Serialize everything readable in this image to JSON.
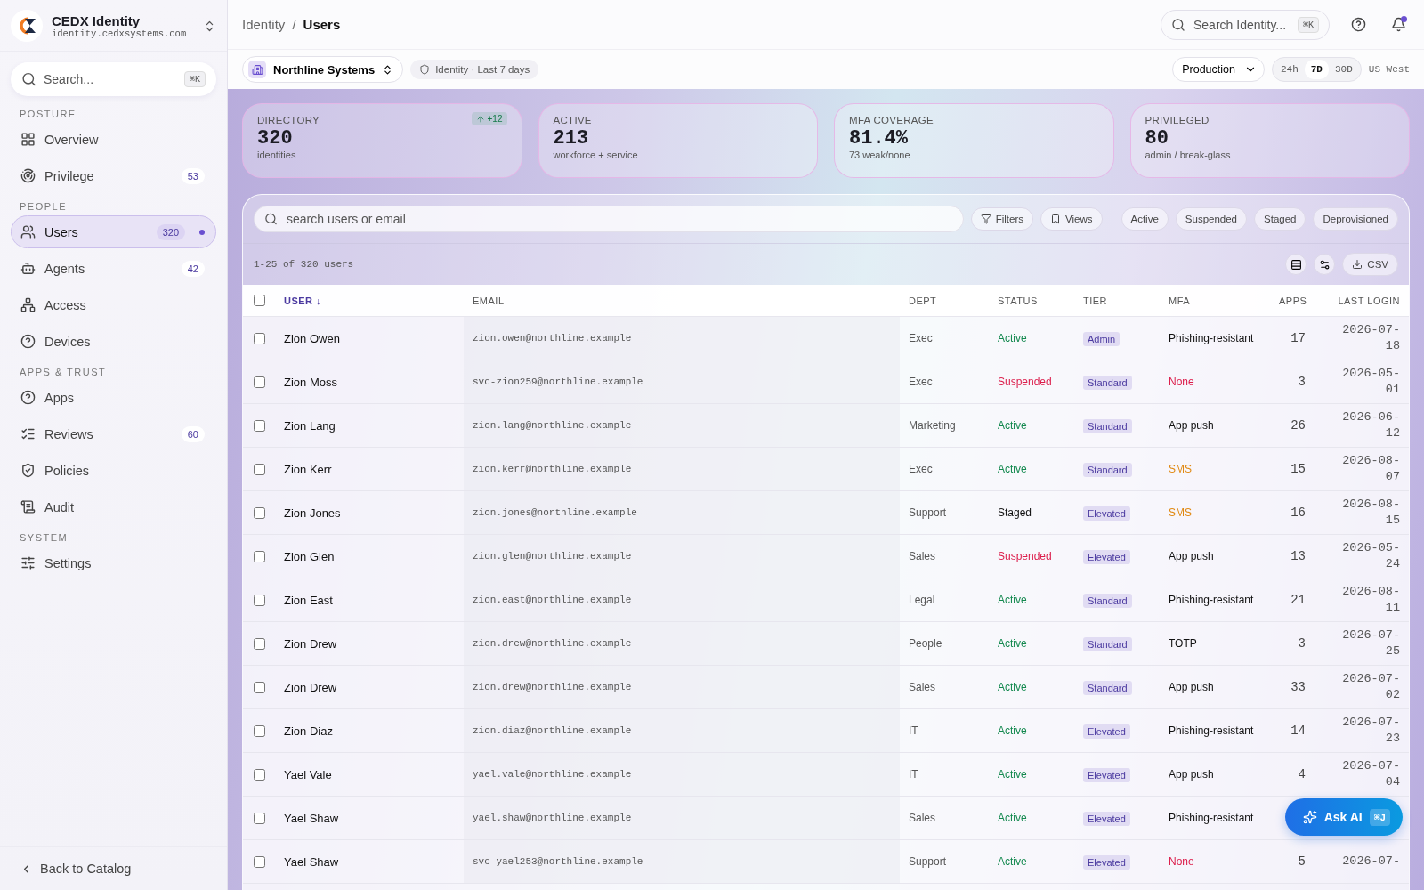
{
  "brand": {
    "name": "CEDX Identity",
    "domain": "identity.cedxsystems.com"
  },
  "sidebar": {
    "search": {
      "placeholder": "Search...",
      "shortcut": "⌘K"
    },
    "sections": [
      {
        "title": "POSTURE",
        "items": [
          {
            "label": "Overview",
            "selected": false
          },
          {
            "label": "Privilege",
            "count": "53",
            "selected": false
          }
        ]
      },
      {
        "title": "PEOPLE",
        "items": [
          {
            "label": "Users",
            "count": "320",
            "selected": true
          },
          {
            "label": "Agents",
            "count": "42",
            "selected": false
          },
          {
            "label": "Access",
            "selected": false
          },
          {
            "label": "Devices",
            "selected": false
          }
        ]
      },
      {
        "title": "APPS & TRUST",
        "items": [
          {
            "label": "Apps",
            "selected": false
          },
          {
            "label": "Reviews",
            "count": "60",
            "selected": false
          },
          {
            "label": "Policies",
            "selected": false
          },
          {
            "label": "Audit",
            "selected": false
          }
        ]
      },
      {
        "title": "SYSTEM",
        "items": [
          {
            "label": "Settings",
            "selected": false
          }
        ]
      }
    ],
    "back": "Back to Catalog"
  },
  "breadcrumb": {
    "items": [
      "Identity",
      "Users"
    ],
    "separator": "/"
  },
  "topbar": {
    "search": {
      "placeholder": "Search Identity...",
      "shortcut": "⌘K"
    },
    "notification_dot": true
  },
  "context": {
    "org": "Northline Systems",
    "scope": "Identity · Last 7 days",
    "environment": "Production",
    "ranges": [
      {
        "label": "24h",
        "selected": false
      },
      {
        "label": "7D",
        "selected": true
      },
      {
        "label": "30D",
        "selected": false
      }
    ],
    "region": "US West"
  },
  "stats": [
    {
      "label": "DIRECTORY",
      "value": "320",
      "sub": "identities",
      "delta": "+12"
    },
    {
      "label": "ACTIVE",
      "value": "213",
      "sub": "workforce + service"
    },
    {
      "label": "MFA COVERAGE",
      "value": "81.4%",
      "sub": "73 weak/none"
    },
    {
      "label": "PRIVILEGED",
      "value": "80",
      "sub": "admin / break-glass"
    }
  ],
  "toolbar": {
    "search": {
      "placeholder": "search users or email"
    },
    "filters": "Filters",
    "views": "Views",
    "chips": [
      "Active",
      "Suspended",
      "Staged",
      "Deprovisioned"
    ],
    "count": "1-25 of 320 users",
    "csv": "CSV"
  },
  "table": {
    "select_all_checked": false,
    "columns": [
      "USER ↓",
      "EMAIL",
      "DEPT",
      "STATUS",
      "TIER",
      "MFA",
      "APPS",
      "LAST LOGIN"
    ],
    "rows": [
      {
        "checked": false,
        "user": "Zion Owen",
        "email": "zion.owen@northline.example",
        "dept": "Exec",
        "status": {
          "text": "Active",
          "kind": "active"
        },
        "tier": "Admin",
        "mfa": {
          "text": "Phishing-resistant",
          "kind": "normal"
        },
        "apps": "17",
        "last_login": "2026-07-18"
      },
      {
        "checked": false,
        "user": "Zion Moss",
        "email": "svc-zion259@northline.example",
        "dept": "Exec",
        "status": {
          "text": "Suspended",
          "kind": "suspended"
        },
        "tier": "Standard",
        "mfa": {
          "text": "None",
          "kind": "none"
        },
        "apps": "3",
        "last_login": "2026-05-01"
      },
      {
        "checked": false,
        "user": "Zion Lang",
        "email": "zion.lang@northline.example",
        "dept": "Marketing",
        "status": {
          "text": "Active",
          "kind": "active"
        },
        "tier": "Standard",
        "mfa": {
          "text": "App push",
          "kind": "normal"
        },
        "apps": "26",
        "last_login": "2026-06-12"
      },
      {
        "checked": false,
        "user": "Zion Kerr",
        "email": "zion.kerr@northline.example",
        "dept": "Exec",
        "status": {
          "text": "Active",
          "kind": "active"
        },
        "tier": "Standard",
        "mfa": {
          "text": "SMS",
          "kind": "weak"
        },
        "apps": "15",
        "last_login": "2026-08-07"
      },
      {
        "checked": false,
        "user": "Zion Jones",
        "email": "zion.jones@northline.example",
        "dept": "Support",
        "status": {
          "text": "Staged",
          "kind": "staged"
        },
        "tier": "Elevated",
        "mfa": {
          "text": "SMS",
          "kind": "weak"
        },
        "apps": "16",
        "last_login": "2026-08-15"
      },
      {
        "checked": false,
        "user": "Zion Glen",
        "email": "zion.glen@northline.example",
        "dept": "Sales",
        "status": {
          "text": "Suspended",
          "kind": "suspended"
        },
        "tier": "Elevated",
        "mfa": {
          "text": "App push",
          "kind": "normal"
        },
        "apps": "13",
        "last_login": "2026-05-24"
      },
      {
        "checked": false,
        "user": "Zion East",
        "email": "zion.east@northline.example",
        "dept": "Legal",
        "status": {
          "text": "Active",
          "kind": "active"
        },
        "tier": "Standard",
        "mfa": {
          "text": "Phishing-resistant",
          "kind": "normal"
        },
        "apps": "21",
        "last_login": "2026-08-11"
      },
      {
        "checked": false,
        "user": "Zion Drew",
        "email": "zion.drew@northline.example",
        "dept": "People",
        "status": {
          "text": "Active",
          "kind": "active"
        },
        "tier": "Standard",
        "mfa": {
          "text": "TOTP",
          "kind": "normal"
        },
        "apps": "3",
        "last_login": "2026-07-25"
      },
      {
        "checked": false,
        "user": "Zion Drew",
        "email": "zion.drew@northline.example",
        "dept": "Sales",
        "status": {
          "text": "Active",
          "kind": "active"
        },
        "tier": "Standard",
        "mfa": {
          "text": "App push",
          "kind": "normal"
        },
        "apps": "33",
        "last_login": "2026-07-02"
      },
      {
        "checked": false,
        "user": "Zion Diaz",
        "email": "zion.diaz@northline.example",
        "dept": "IT",
        "status": {
          "text": "Active",
          "kind": "active"
        },
        "tier": "Elevated",
        "mfa": {
          "text": "Phishing-resistant",
          "kind": "normal"
        },
        "apps": "14",
        "last_login": "2026-07-23"
      },
      {
        "checked": false,
        "user": "Yael Vale",
        "email": "yael.vale@northline.example",
        "dept": "IT",
        "status": {
          "text": "Active",
          "kind": "active"
        },
        "tier": "Elevated",
        "mfa": {
          "text": "App push",
          "kind": "normal"
        },
        "apps": "4",
        "last_login": "2026-07-04"
      },
      {
        "checked": false,
        "user": "Yael Shaw",
        "email": "yael.shaw@northline.example",
        "dept": "Sales",
        "status": {
          "text": "Active",
          "kind": "active"
        },
        "tier": "Elevated",
        "mfa": {
          "text": "Phishing-resistant",
          "kind": "normal"
        }
      },
      {
        "checked": false,
        "user": "Yael Shaw",
        "email": "svc-yael253@northline.example",
        "dept": "Support",
        "status": {
          "text": "Active",
          "kind": "active"
        },
        "tier": "Elevated",
        "mfa": {
          "text": "None",
          "kind": "none"
        },
        "apps": "5",
        "last_login": "2026-07-"
      }
    ]
  },
  "ask_ai": {
    "label": "Ask AI",
    "shortcut": "⌘J"
  }
}
